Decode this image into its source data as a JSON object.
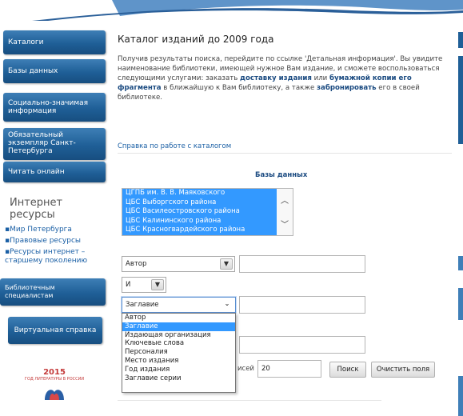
{
  "sidebar": {
    "buttons": [
      {
        "label": "Каталоги"
      },
      {
        "label": "Базы данных"
      },
      {
        "label": "Социально-значимая информация"
      },
      {
        "label": "Обязательный экземпляр Санкт-Петербурга"
      },
      {
        "label": "Читать онлайн"
      }
    ],
    "internet_heading": "Интернет ресурсы",
    "internet_links": [
      {
        "label": "Мир Петербурга"
      },
      {
        "label": "Правовые ресурсы"
      },
      {
        "label": "Ресурсы интернет – старшему поколению"
      }
    ],
    "specialists_button": "Библиотечным специалистам",
    "virtual_help_button": "Виртуальная справка",
    "year_badge": {
      "year": "2015",
      "subtitle": "ГОД ЛИТЕРАТУРЫ В РОССИИ"
    }
  },
  "main": {
    "title": "Каталог изданий до 2009 года",
    "intro": {
      "part1": "Получив результаты поиска, перейдите по ссылке 'Детальная информация'. Вы увидите наименование библиотеки, имеющей нужное Вам издание, и сможете воспользоваться следующими услугами: заказать ",
      "delivery": "доставку издания",
      "part2": " или ",
      "paper_copy": "бумажной копии его фрагмента",
      "part3": " в ближайшую к Вам библиотеку, а также ",
      "reserve": "забронировать",
      "part4": " его в своей библиотеке."
    },
    "help_link": "Справка по работе с каталогом",
    "databases_label": "Базы данных",
    "databases": [
      "ЦГПБ им. В. В. Маяковского",
      "ЦБС Выборгского района",
      "ЦБС Василеостровского района",
      "ЦБС Калининского района",
      "ЦБС Красногвардейского района"
    ],
    "field1_select": "Автор",
    "operator_select": "И",
    "field2_select": "Заглавие",
    "dropdown_options": [
      "Автор",
      "Заглавие",
      "Издающая организация",
      "Ключевые слова",
      "Персоналия",
      "Место издания",
      "Год издания",
      "Заглавие серии"
    ],
    "dropdown_selected_index": 1,
    "records_label": "исей",
    "records_value": "20",
    "search_button": "Поиск",
    "clear_button": "Очистить поля"
  },
  "colors": {
    "sidebar_button": "#1f5f97",
    "link": "#1a5fa5",
    "selection": "#3399ff"
  }
}
